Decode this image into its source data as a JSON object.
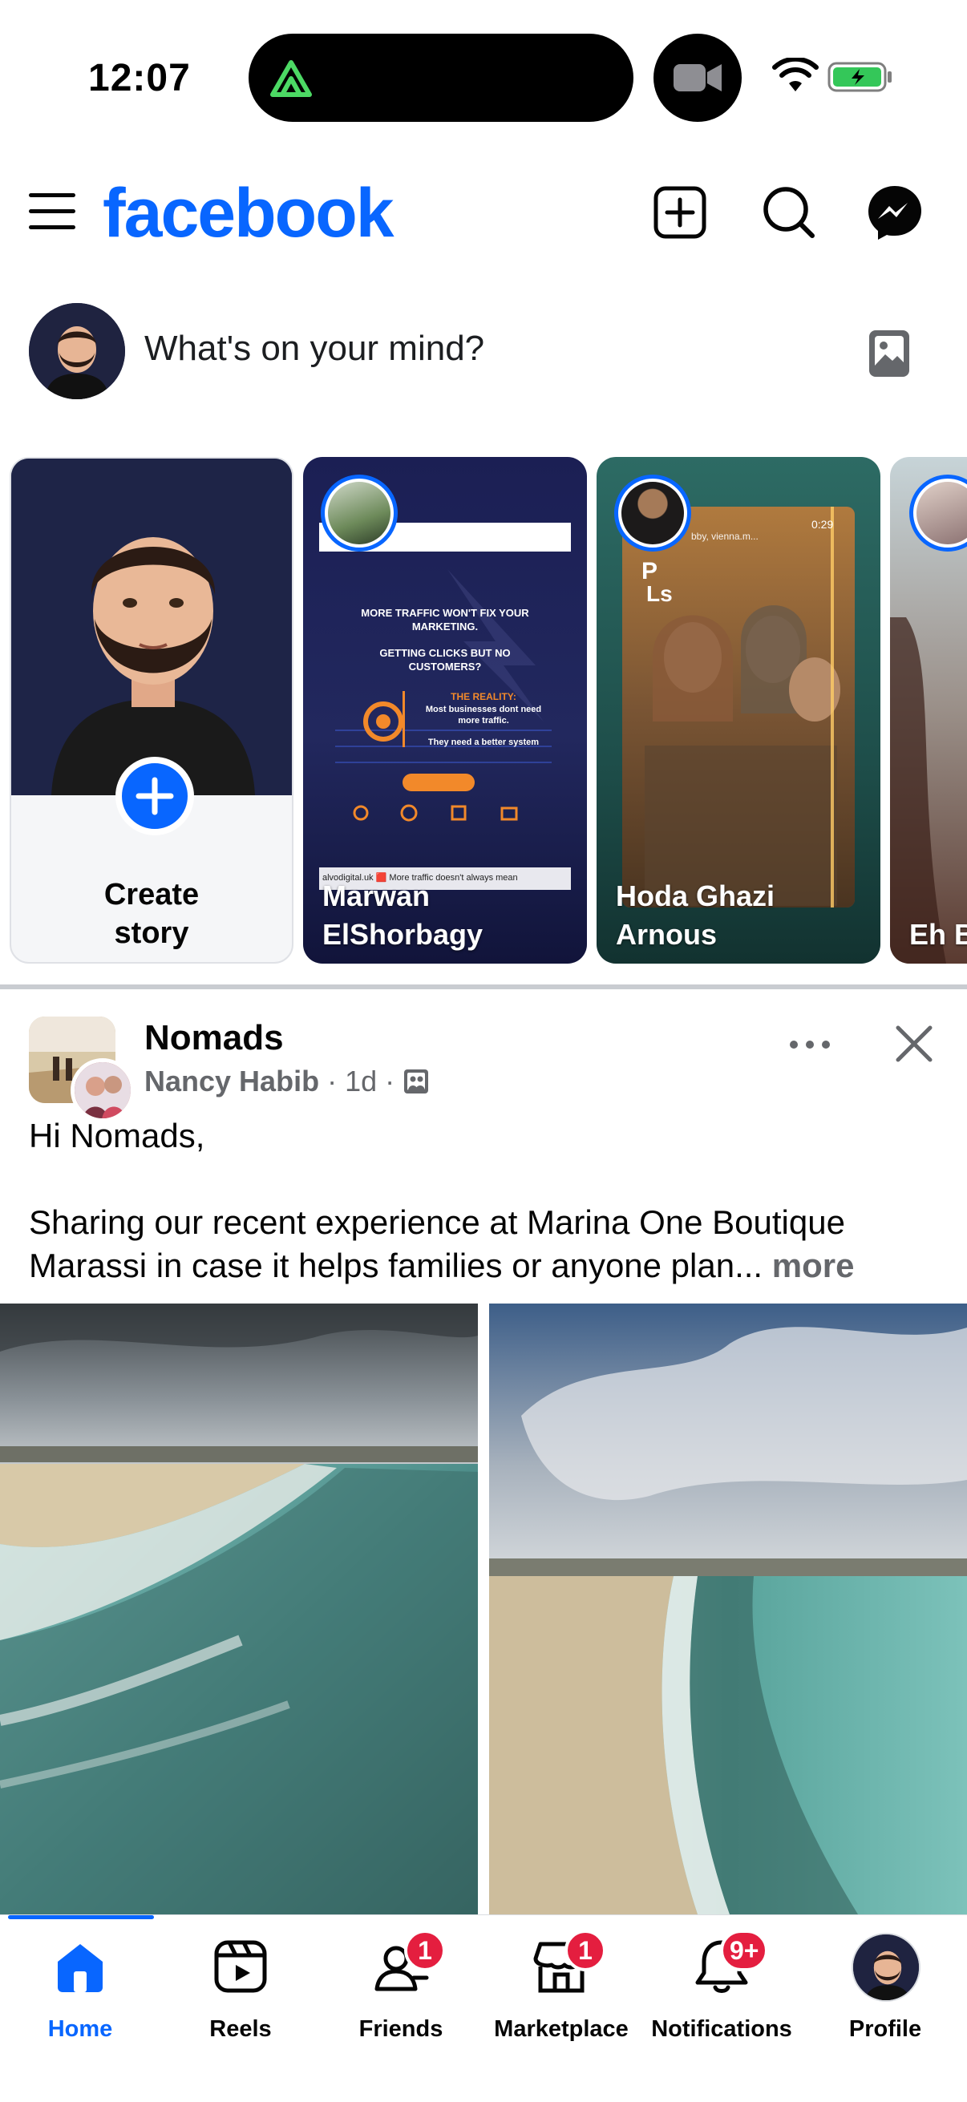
{
  "status_bar": {
    "time": "12:07"
  },
  "header": {
    "logo": "facebook"
  },
  "composer": {
    "placeholder": "What's on your mind?"
  },
  "stories": [
    {
      "name": "Create story",
      "type": "create"
    },
    {
      "name": "Marwan ElShorbagy",
      "line1": "Marwan",
      "line2": "ElShorbagy",
      "caption_top": "MORE TRAFFIC WON'T FIX YOUR MARKETING.",
      "caption_mid": "GETTING CLICKS BUT NO CUSTOMERS?",
      "caption_reality": "THE REALITY:",
      "caption_reality_body": "Most businesses dont need more traffic.",
      "caption_need": "They need a better system",
      "footer": "alvodigital.uk 🟥 More traffic doesn't always mean"
    },
    {
      "name": "Hoda Ghazi Arnous",
      "line1": "Hoda Ghazi",
      "line2": "Arnous",
      "duration": "0:29",
      "tag": "bby, vienna.m..."
    },
    {
      "name": "Eh B",
      "line1": "Eh B"
    }
  ],
  "create_story": {
    "line1": "Create",
    "line2": "story"
  },
  "post": {
    "group": "Nomads",
    "author": "Nancy Habib",
    "time": "1d",
    "greeting": "Hi Nomads,",
    "body": "Sharing our recent experience at Marina One Boutique Marassi in case it helps families or anyone plan...",
    "more": "more"
  },
  "bottom_nav": {
    "home": "Home",
    "reels": "Reels",
    "friends": "Friends",
    "friends_badge": "1",
    "marketplace": "Marketplace",
    "marketplace_badge": "1",
    "notifications": "Notifications",
    "notifications_badge": "9+",
    "profile": "Profile"
  },
  "colors": {
    "brand": "#0866ff",
    "badge": "#e41e3f",
    "muted": "#65676b"
  }
}
